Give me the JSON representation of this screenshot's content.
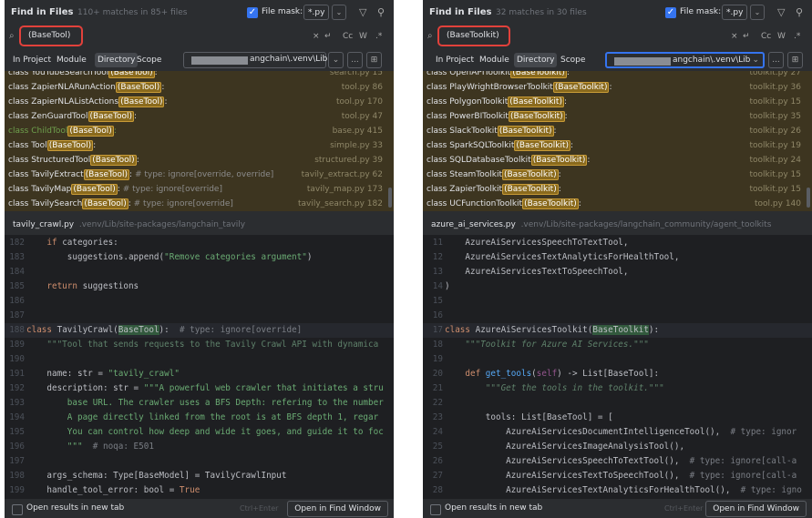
{
  "panels": [
    {
      "header": {
        "title": "Find in Files",
        "matches": "110+ matches in 85+ files",
        "file_mask_label": "File mask:",
        "file_mask_value": "*.py"
      },
      "query": "(BaseTool)",
      "options": {
        "case": "Cc",
        "word": "W",
        "regex": ".*"
      },
      "scope_tabs": [
        "In Project",
        "Module",
        "Directory",
        "Scope"
      ],
      "active_scope": "Directory",
      "directory_path": "angchain\\.venv\\Lib",
      "results": [
        {
          "prefix": "class YouTubeSearchTool",
          "match": "(BaseTool)",
          "suffix": ":",
          "file": "search.py 15"
        },
        {
          "prefix": "class ZapierNLARunAction",
          "match": "(BaseTool)",
          "suffix": ":",
          "file": "tool.py 86"
        },
        {
          "prefix": "class ZapierNLAListActions",
          "match": "(BaseTool)",
          "suffix": ":",
          "file": "tool.py 170"
        },
        {
          "prefix": "class ZenGuardTool",
          "match": "(BaseTool)",
          "suffix": ":",
          "file": "tool.py 47"
        },
        {
          "prefix": "class ChildTool",
          "match": "(BaseTool)",
          "suffix": ":",
          "file": "base.py 415"
        },
        {
          "prefix": "class Tool",
          "match": "(BaseTool)",
          "suffix": ":",
          "file": "simple.py 33"
        },
        {
          "prefix": "class StructuredTool",
          "match": "(BaseTool)",
          "suffix": ":",
          "file": "structured.py 39"
        },
        {
          "prefix": "class TavilyExtract",
          "match": "(BaseTool)",
          "suffix": ":",
          "comment": "# type: ignore[override, override]",
          "file": "tavily_extract.py 62"
        },
        {
          "prefix": "class TavilyMap",
          "match": "(BaseTool)",
          "suffix": ":",
          "comment": "# type: ignore[override]",
          "file": "tavily_map.py 173"
        },
        {
          "prefix": "class TavilySearch",
          "match": "(BaseTool)",
          "suffix": ":",
          "comment": "# type: ignore[override]",
          "file": "tavily_search.py 182"
        }
      ],
      "file_name": "tavily_crawl.py",
      "file_path": ".venv/Lib/site-packages/langchain_tavily",
      "code_lines": [
        {
          "num": "182",
          "text": "    if categories:"
        },
        {
          "num": "183",
          "text": "        suggestions.append(\"Remove categories argument\")"
        },
        {
          "num": "184",
          "text": ""
        },
        {
          "num": "185",
          "text": "    return suggestions"
        },
        {
          "num": "186",
          "text": ""
        },
        {
          "num": "187",
          "text": ""
        },
        {
          "num": "188",
          "text": "class TavilyCrawl(BaseTool):  # type: ignore[override]"
        },
        {
          "num": "189",
          "text": "    \"\"\"Tool that sends requests to the Tavily Crawl API with dynamica"
        },
        {
          "num": "190",
          "text": ""
        },
        {
          "num": "191",
          "text": "    name: str = \"tavily_crawl\""
        },
        {
          "num": "192",
          "text": "    description: str = \"\"\"A powerful web crawler that initiates a stru"
        },
        {
          "num": "193",
          "text": "        base URL. The crawler uses a BFS Depth: refering to the number"
        },
        {
          "num": "194",
          "text": "        A page directly linked from the root is at BFS depth 1, regar"
        },
        {
          "num": "195",
          "text": "        You can control how deep and wide it goes, and guide it to foc"
        },
        {
          "num": "196",
          "text": "        \"\"\"  # noqa: E501"
        },
        {
          "num": "197",
          "text": ""
        },
        {
          "num": "198",
          "text": "    args_schema: Type[BaseModel] = TavilyCrawlInput"
        },
        {
          "num": "199",
          "text": "    handle_tool_error: bool = True"
        }
      ],
      "footer": {
        "checkbox_label": "Open results in new tab",
        "shortcut": "Ctrl+Enter",
        "button": "Open in Find Window"
      }
    },
    {
      "header": {
        "title": "Find in Files",
        "matches": "32 matches in 30 files",
        "file_mask_label": "File mask:",
        "file_mask_value": "*.py"
      },
      "query": "(BaseToolkit)",
      "options": {
        "case": "Cc",
        "word": "W",
        "regex": ".*"
      },
      "scope_tabs": [
        "In Project",
        "Module",
        "Directory",
        "Scope"
      ],
      "active_scope": "Directory",
      "directory_path": "angchain\\.venv\\Lib",
      "results": [
        {
          "prefix": "class OpenAPIToolkit",
          "match": "(BaseToolkit)",
          "suffix": ":",
          "file": "toolkit.py 27"
        },
        {
          "prefix": "class PlayWrightBrowserToolkit",
          "match": "(BaseToolkit)",
          "suffix": ":",
          "file": "toolkit.py 36"
        },
        {
          "prefix": "class PolygonToolkit",
          "match": "(BaseToolkit)",
          "suffix": ":",
          "file": "toolkit.py 15"
        },
        {
          "prefix": "class PowerBIToolkit",
          "match": "(BaseToolkit)",
          "suffix": ":",
          "file": "toolkit.py 35"
        },
        {
          "prefix": "class SlackToolkit",
          "match": "(BaseToolkit)",
          "suffix": ":",
          "file": "toolkit.py 26"
        },
        {
          "prefix": "class SparkSQLToolkit",
          "match": "(BaseToolkit)",
          "suffix": ":",
          "file": "toolkit.py 19"
        },
        {
          "prefix": "class SQLDatabaseToolkit",
          "match": "(BaseToolkit)",
          "suffix": ":",
          "file": "toolkit.py 24"
        },
        {
          "prefix": "class SteamToolkit",
          "match": "(BaseToolkit)",
          "suffix": ":",
          "file": "toolkit.py 15"
        },
        {
          "prefix": "class ZapierToolkit",
          "match": "(BaseToolkit)",
          "suffix": ":",
          "file": "toolkit.py 15"
        },
        {
          "prefix": "class UCFunctionToolkit",
          "match": "(BaseToolkit)",
          "suffix": ":",
          "file": "tool.py 140"
        }
      ],
      "file_name": "azure_ai_services.py",
      "file_path": ".venv/Lib/site-packages/langchain_community/agent_toolkits",
      "code_lines": [
        {
          "num": "11",
          "text": "    AzureAiServicesSpeechToTextTool,"
        },
        {
          "num": "12",
          "text": "    AzureAiServicesTextAnalyticsForHealthTool,"
        },
        {
          "num": "13",
          "text": "    AzureAiServicesTextToSpeechTool,"
        },
        {
          "num": "14",
          "text": ")"
        },
        {
          "num": "15",
          "text": ""
        },
        {
          "num": "16",
          "text": ""
        },
        {
          "num": "17",
          "text": "class AzureAiServicesToolkit(BaseToolkit):"
        },
        {
          "num": "18",
          "text": "    \"\"\"Toolkit for Azure AI Services.\"\"\""
        },
        {
          "num": "19",
          "text": ""
        },
        {
          "num": "20",
          "text": "    def get_tools(self) -> List[BaseTool]:"
        },
        {
          "num": "21",
          "text": "        \"\"\"Get the tools in the toolkit.\"\"\""
        },
        {
          "num": "22",
          "text": ""
        },
        {
          "num": "23",
          "text": "        tools: List[BaseTool] = ["
        },
        {
          "num": "24",
          "text": "            AzureAiServicesDocumentIntelligenceTool(),  # type: ignor"
        },
        {
          "num": "25",
          "text": "            AzureAiServicesImageAnalysisTool(),"
        },
        {
          "num": "26",
          "text": "            AzureAiServicesSpeechToTextTool(),  # type: ignore[call-a"
        },
        {
          "num": "27",
          "text": "            AzureAiServicesTextToSpeechTool(),  # type: ignore[call-a"
        },
        {
          "num": "28",
          "text": "            AzureAiServicesTextAnalyticsForHealthTool(),  # type: igno"
        }
      ],
      "footer": {
        "checkbox_label": "Open results in new tab",
        "shortcut": "Ctrl+Enter",
        "button": "Open in Find Window"
      }
    }
  ]
}
